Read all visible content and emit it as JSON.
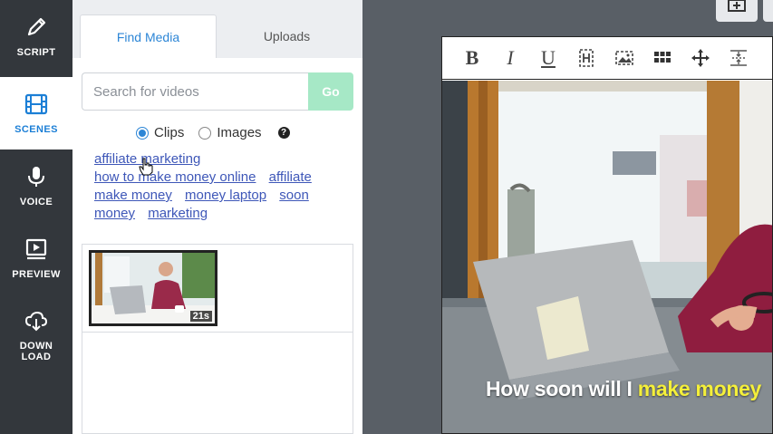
{
  "nav": {
    "items": [
      {
        "label": "SCRIPT",
        "icon": "pencil-icon"
      },
      {
        "label": "SCENES",
        "icon": "film-icon",
        "active": true
      },
      {
        "label": "VOICE",
        "icon": "microphone-icon"
      },
      {
        "label": "PREVIEW",
        "icon": "play-preview-icon"
      },
      {
        "label_line1": "DOWN",
        "label_line2": "LOAD",
        "icon": "cloud-download-icon"
      }
    ]
  },
  "panel": {
    "tabs": [
      {
        "label": "Find Media",
        "active": true
      },
      {
        "label": "Uploads",
        "active": false
      }
    ],
    "search": {
      "placeholder": "Search for videos",
      "value": "",
      "go_label": "Go"
    },
    "media_type": {
      "options": [
        "Clips",
        "Images"
      ],
      "selected": "Clips",
      "help_glyph": "?"
    },
    "tags": [
      "affiliate marketing",
      "how to make money online",
      "affiliate",
      "make money",
      "money laptop",
      "soon",
      "money",
      "marketing"
    ],
    "results": [
      {
        "duration": "21s"
      }
    ]
  },
  "editor": {
    "toolbar": {
      "bold": "B",
      "italic": "I",
      "underline": "U"
    },
    "caption": {
      "plain": "How soon will I ",
      "highlight": "make money"
    }
  },
  "colors": {
    "accent": "#2d86d6",
    "go_button": "#a6e8c6",
    "link": "#3e57b8",
    "caption_highlight": "#f4ef3a",
    "nav_bg": "#33373c"
  }
}
